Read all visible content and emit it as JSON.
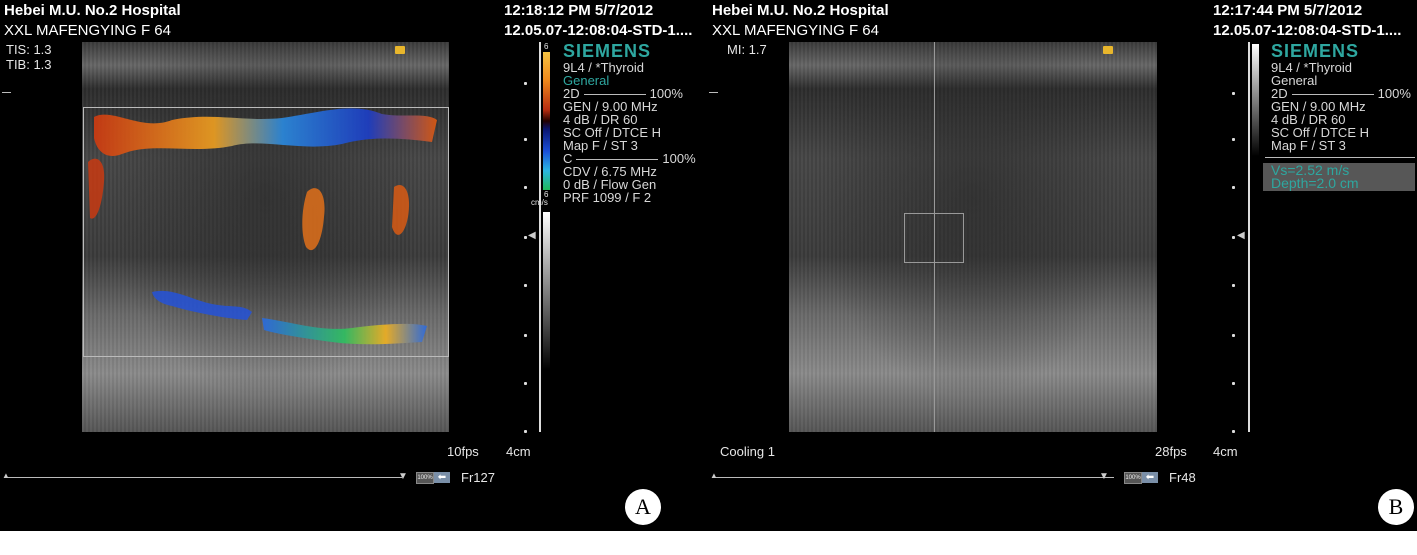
{
  "panel_a": {
    "hospital": "Hebei  M.U. No.2 Hospital",
    "datetime": "12:18:12 PM 5/7/2012",
    "patient": "XXL  MAFENGYING F  64",
    "study_id": "12.05.07-12:08:04-STD-1....",
    "tis": "TIS: 1.3",
    "tib": "TIB: 1.3",
    "brand": "SIEMENS",
    "probe": "9L4 / *Thyroid",
    "preset": "General",
    "mode_2d": "2D",
    "mode_2d_pct": "100%",
    "gen": "GEN / 9.00 MHz",
    "db_dr": "4 dB / DR 60",
    "sc": "SC Off / DTCE H",
    "map": "Map F / ST 3",
    "mode_c": "C",
    "mode_c_pct": "100%",
    "cdv": "CDV / 6.75 MHz",
    "flow": "0 dB / Flow Gen",
    "prf": "PRF 1099 / F 2",
    "scale_top": "6",
    "scale_bottom": "6",
    "scale_unit": "cm/s",
    "fps": "10fps",
    "depth": "4cm",
    "frame": "Fr127",
    "label": "A",
    "badge": "100%",
    "arrow_icon": "left-arrow-icon"
  },
  "panel_b": {
    "hospital": "Hebei  M.U. No.2 Hospital",
    "datetime": "12:17:44 PM 5/7/2012",
    "patient": "XXL  MAFENGYING F  64",
    "study_id": "12.05.07-12:08:04-STD-1....",
    "mi": "MI:  1.7",
    "brand": "SIEMENS",
    "probe": "9L4 / *Thyroid",
    "preset": "General",
    "mode_2d": "2D",
    "mode_2d_pct": "100%",
    "gen": "GEN / 9.00 MHz",
    "db_dr": "4 dB / DR 60",
    "sc": "SC Off / DTCE H",
    "map": "Map F / ST 3",
    "vs": "Vs=2.52 m/s",
    "vs_depth": "Depth=2.0 cm",
    "cooling": "Cooling 1",
    "fps": "28fps",
    "depth": "4cm",
    "frame": "Fr48",
    "label": "B",
    "badge": "100%",
    "arrow_icon": "left-arrow-icon"
  },
  "colors": {
    "background": "#000000",
    "brand": "#2ea7a0",
    "velocity_box": "#575757",
    "arrow_button": "#7a8fa8"
  }
}
